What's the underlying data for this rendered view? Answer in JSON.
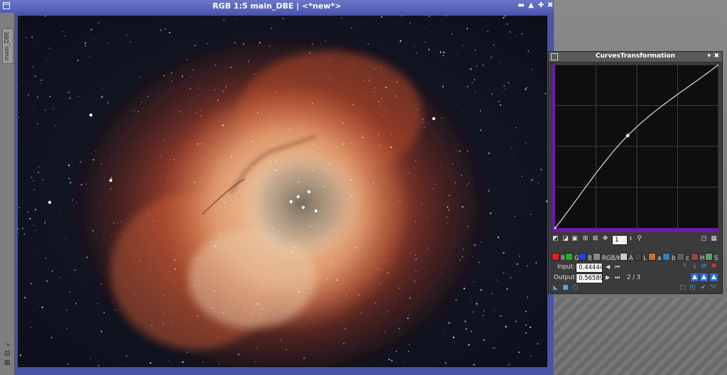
{
  "image_window": {
    "title": "RGB 1:5 main_DBE | <*new*>",
    "side_tab": "main_DBE",
    "buttons": [
      "minimize-icon",
      "shade-icon",
      "pin-icon",
      "close-icon"
    ]
  },
  "curves": {
    "title": "CurvesTransformation",
    "zoom_value": "1",
    "channels": [
      {
        "key": "R",
        "color": "#e02020"
      },
      {
        "key": "G",
        "color": "#20b020"
      },
      {
        "key": "B",
        "color": "#2040e0"
      },
      {
        "key": "RGB/K",
        "color": "#888888"
      },
      {
        "key": "A",
        "color": "#cccccc"
      },
      {
        "key": "L",
        "color": "#444444"
      },
      {
        "key": "a",
        "color": "#d07020"
      },
      {
        "key": "b",
        "color": "#3080c0"
      },
      {
        "key": "c",
        "color": "#606060"
      },
      {
        "key": "H",
        "color": "#a04040"
      },
      {
        "key": "S",
        "color": "#60a060"
      }
    ],
    "input_label": "Input:",
    "input_value": "0.44444",
    "output_label": "Output:",
    "output_value": "0.56589",
    "point_index": "2 / 3",
    "curve_points": [
      [
        0,
        0
      ],
      [
        0.44444,
        0.56589
      ],
      [
        1,
        1
      ]
    ]
  }
}
